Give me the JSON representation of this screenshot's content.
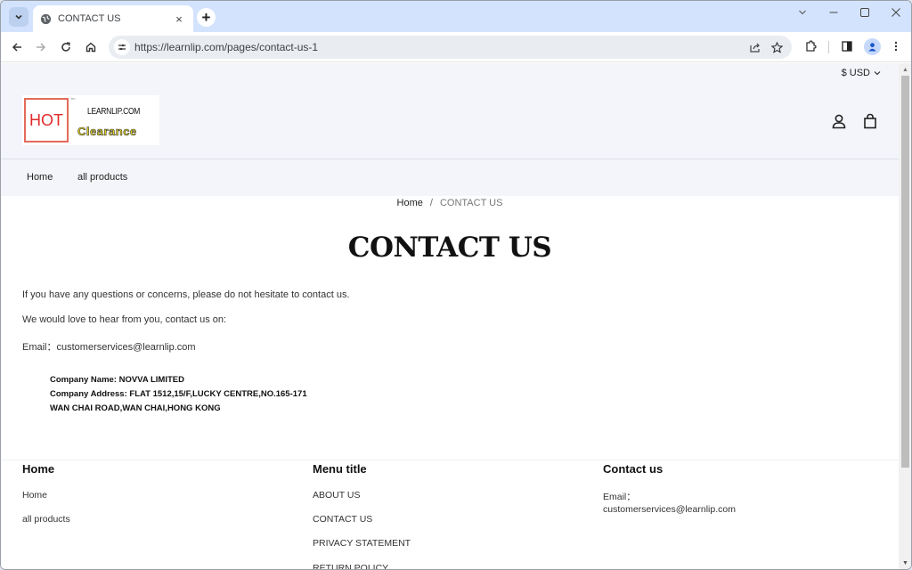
{
  "browser": {
    "tab": {
      "title": "CONTACT US",
      "icon": "globe-icon"
    },
    "url": "https://learnlip.com/pages/contact-us-1",
    "icons": {
      "tab_menu": "chevron-down-icon",
      "close_tab": "×",
      "new_tab": "+",
      "back": "←",
      "forward": "→",
      "reload": "⟳",
      "home": "⌂",
      "share": "share-icon",
      "bookmark": "☆",
      "extensions": "puzzle-icon",
      "side_panel": "side-panel-icon",
      "profile": "profile-icon",
      "menu": "⋮"
    },
    "window_controls": {
      "dropdown": "⌄",
      "minimize": "—",
      "maximize": "☐",
      "close": "✕"
    }
  },
  "header": {
    "currency": "$ USD",
    "logo": {
      "hot": "HOT",
      "tm": "tm",
      "site": "LEARNLIP.COM",
      "tagline": "Clearance"
    },
    "nav": [
      {
        "label": "Home"
      },
      {
        "label": "all products"
      }
    ]
  },
  "breadcrumb": {
    "home": "Home",
    "separator": "/",
    "current": "CONTACT US"
  },
  "content": {
    "title": "CONTACT US",
    "paragraphs": [
      "If you have any questions or concerns, please do not hesitate to contact us.",
      "We would love to hear from you, contact us on:",
      "Email：customerservices@learnlip.com"
    ],
    "company": [
      "Company Name: NOVVA LIMITED",
      "Company Address: FLAT 1512,15/F,LUCKY CENTRE,NO.165-171",
      "WAN CHAI ROAD,WAN CHAI,HONG KONG"
    ]
  },
  "footer": {
    "columns": [
      {
        "heading": "Home",
        "links": [
          "Home",
          "all products"
        ]
      },
      {
        "heading": "Menu title",
        "links": [
          "ABOUT US",
          "CONTACT US",
          "PRIVACY STATEMENT",
          "RETURN POLICY"
        ]
      },
      {
        "heading": "Contact us",
        "lines": [
          "Email：",
          "customerservices@learnlip.com"
        ]
      }
    ]
  }
}
